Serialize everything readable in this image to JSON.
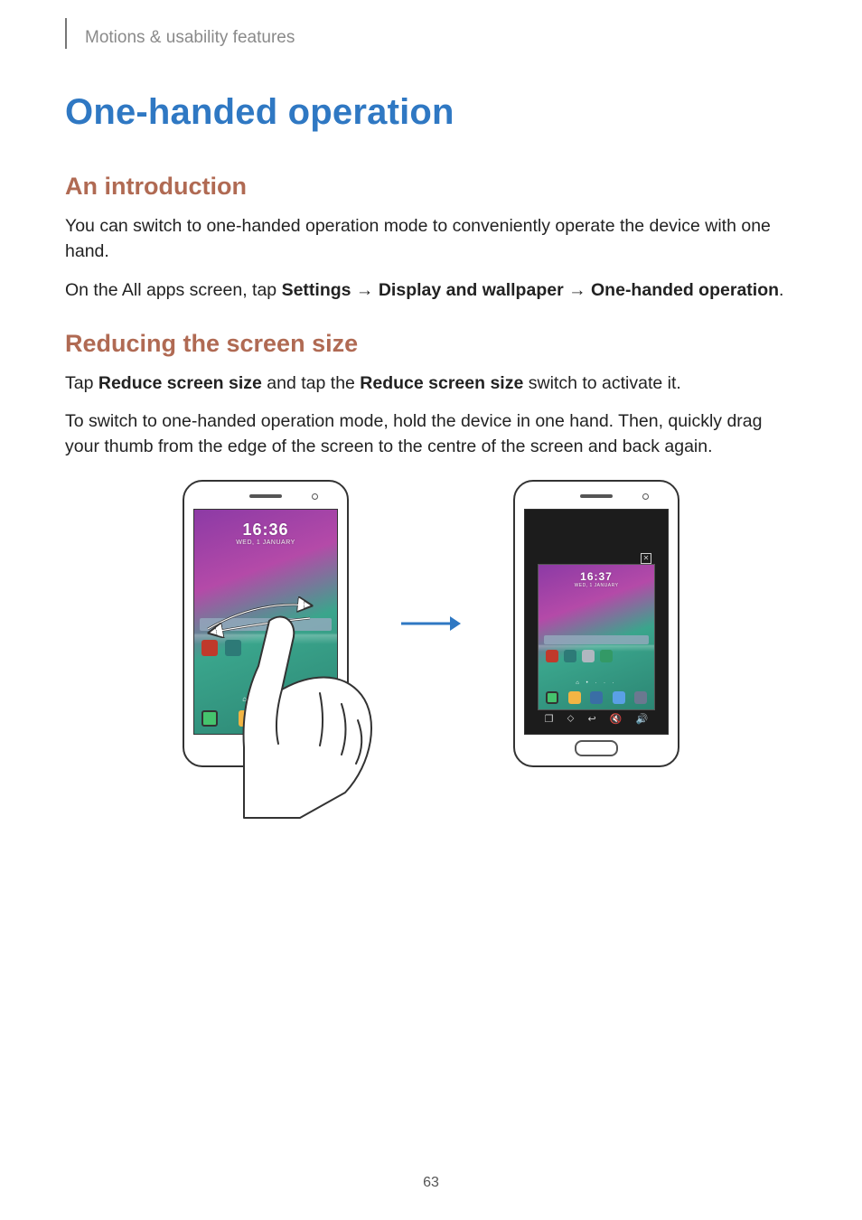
{
  "header": {
    "breadcrumb": "Motions & usability features"
  },
  "title": "One-handed operation",
  "section1": {
    "heading": "An introduction",
    "p1": "You can switch to one-handed operation mode to conveniently operate the device with one hand.",
    "p2_pre": "On the All apps screen, tap ",
    "p2_b1": "Settings",
    "p2_arrow": " → ",
    "p2_b2": "Display and wallpaper",
    "p2_b3": "One-handed operation",
    "p2_end": "."
  },
  "section2": {
    "heading": "Reducing the screen size",
    "p1_pre": "Tap ",
    "p1_b1": "Reduce screen size",
    "p1_mid": " and tap the ",
    "p1_b2": "Reduce screen size",
    "p1_end": " switch to activate it.",
    "p2": "To switch to one-handed operation mode, hold the device in one hand. Then, quickly drag your thumb from the edge of the screen to the centre of the screen and back again."
  },
  "figure": {
    "clock_time": "16:36",
    "clock_date": "WED, 1 JANUARY",
    "mini_clock_time": "16:37",
    "mini_clock_date": "WED, 1 JANUARY"
  },
  "page_number": "63"
}
